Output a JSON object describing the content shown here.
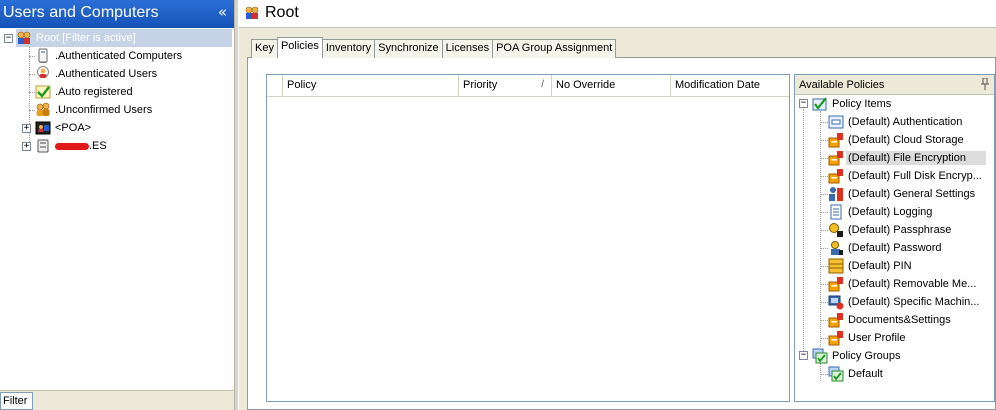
{
  "left_panel": {
    "title": "Users and Computers",
    "collapse_glyph": "«",
    "tree": {
      "root": {
        "label": "Root [Filter is active]",
        "expander": "−"
      },
      "children": [
        {
          "label": ".Authenticated Computers",
          "icon": "computer-icon"
        },
        {
          "label": ".Authenticated Users",
          "icon": "user-icon"
        },
        {
          "label": ".Auto registered",
          "icon": "check-icon"
        },
        {
          "label": ".Unconfirmed Users",
          "icon": "users-icon"
        },
        {
          "label": "<POA>",
          "icon": "poa-icon",
          "expander": "+"
        },
        {
          "label": ".ES",
          "icon": "domain-icon",
          "expander": "+"
        }
      ]
    },
    "filter_tab": "Filter"
  },
  "right_panel": {
    "title": "Root",
    "tabs": [
      {
        "label": "Key",
        "active": false
      },
      {
        "label": "Policies",
        "active": true
      },
      {
        "label": "Inventory",
        "active": false
      },
      {
        "label": "Synchronize",
        "active": false
      },
      {
        "label": "Licenses",
        "active": false
      },
      {
        "label": "POA Group Assignment",
        "active": false
      }
    ],
    "grid": {
      "columns": [
        "Policy",
        "Priority",
        "No Override",
        "Modification Date"
      ],
      "sort_indicator": "/",
      "rows": []
    },
    "available_policies": {
      "title": "Available Policies",
      "groups": [
        {
          "label": "Policy Items",
          "expander": "−",
          "items": [
            {
              "label": "(Default) Authentication",
              "icon": "authentication-icon"
            },
            {
              "label": "(Default) Cloud Storage",
              "icon": "cloud-storage-icon"
            },
            {
              "label": "(Default) File Encryption",
              "icon": "file-encryption-icon",
              "selected": true
            },
            {
              "label": "(Default) Full Disk Encryp...",
              "icon": "full-disk-encryption-icon"
            },
            {
              "label": "(Default) General Settings",
              "icon": "general-settings-icon"
            },
            {
              "label": "(Default) Logging",
              "icon": "logging-icon"
            },
            {
              "label": "(Default) Passphrase",
              "icon": "passphrase-icon"
            },
            {
              "label": "(Default) Password",
              "icon": "password-icon"
            },
            {
              "label": "(Default) PIN",
              "icon": "pin-code-icon"
            },
            {
              "label": "(Default) Removable Me...",
              "icon": "removable-media-icon"
            },
            {
              "label": "(Default) Specific Machin...",
              "icon": "specific-machine-icon"
            },
            {
              "label": "Documents&Settings",
              "icon": "documents-settings-icon"
            },
            {
              "label": "User Profile",
              "icon": "user-profile-icon"
            }
          ]
        },
        {
          "label": "Policy Groups",
          "expander": "−",
          "items": [
            {
              "label": "Default",
              "icon": "policy-group-icon"
            }
          ]
        }
      ]
    }
  },
  "colors": {
    "header_blue": "#1552b8",
    "selection_gray": "#dcdcdc",
    "chrome": "#ece9d8",
    "redaction_red": "#e01818"
  }
}
